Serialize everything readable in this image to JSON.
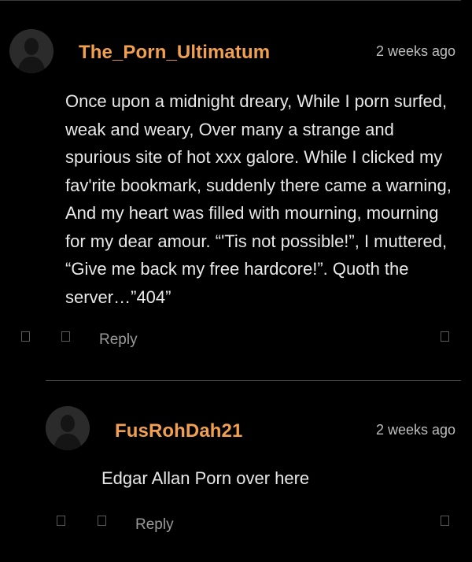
{
  "comments": [
    {
      "username": "The_Porn_Ultimatum",
      "timestamp": "2 weeks ago",
      "text": "Once upon a midnight dreary, While I porn surfed, weak and weary, Over many a strange and spurious site of hot xxx galore. While I clicked my fav'rite bookmark, suddenly there came a warning, And my heart was filled with mourning, mourning for my dear amour. “'Tis not possible!”, I muttered, “Give me back my free hardcore!”. Quoth the server…”404”",
      "reply_label": "Reply",
      "avatar_icon": "default-user-avatar-icon",
      "thumbs_up_icon": "thumbs-up-icon",
      "thumbs_down_icon": "thumbs-down-icon",
      "flag_icon": "flag-icon"
    },
    {
      "username": "FusRohDah21",
      "timestamp": "2 weeks ago",
      "text": "Edgar Allan Porn over here",
      "reply_label": "Reply",
      "avatar_icon": "default-user-avatar-icon",
      "thumbs_up_icon": "thumbs-up-icon",
      "thumbs_down_icon": "thumbs-down-icon",
      "flag_icon": "flag-icon"
    }
  ],
  "colors": {
    "background": "#000000",
    "username": "#f0a050",
    "body_text": "#e8e8e8",
    "meta_text": "#bdbdbd",
    "reply_text": "#9a9a9a"
  }
}
